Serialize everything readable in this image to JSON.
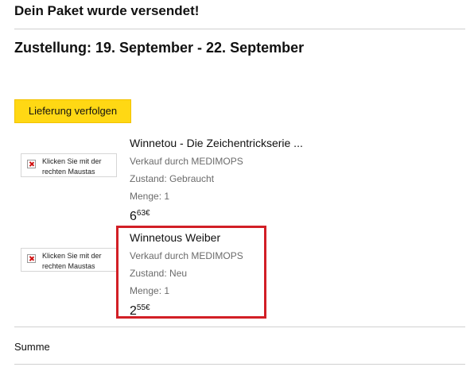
{
  "header": {
    "headline": "Dein Paket wurde versendet!",
    "delivery": "Zustellung: 19. September - 22. September",
    "track_button": "Lieferung verfolgen"
  },
  "items": [
    {
      "image_alt": "Klicken Sie mit der rechten Maustas",
      "title": "Winnetou - Die Zeichentrickserie ...",
      "seller": "Verkauf durch MEDIMOPS",
      "condition": "Zustand: Gebraucht",
      "quantity": "Menge: 1",
      "price_main": "6",
      "price_cents": "63€"
    },
    {
      "image_alt": "Klicken Sie mit der rechten Maustas",
      "title": "Winnetous Weiber",
      "seller": "Verkauf durch MEDIMOPS",
      "condition": "Zustand: Neu",
      "quantity": "Menge: 1",
      "price_main": "2",
      "price_cents": "55€"
    }
  ],
  "footer": {
    "sum_label": "Summe"
  },
  "colors": {
    "button_bg": "#ffd814",
    "highlight": "#d21f26"
  }
}
